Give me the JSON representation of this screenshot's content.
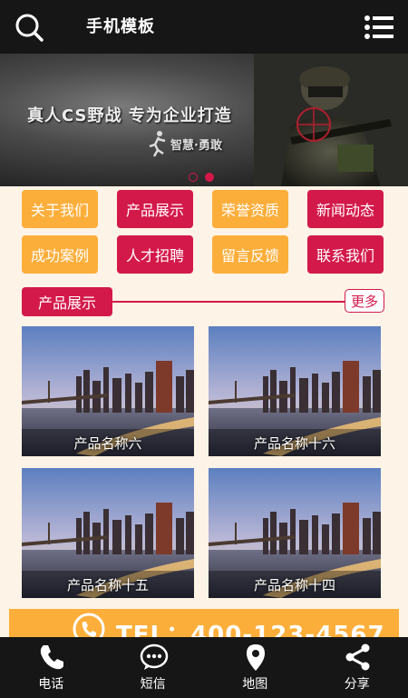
{
  "header": {
    "title": "手机模板",
    "search_icon": "search-icon",
    "menu_icon": "menu-icon"
  },
  "banner": {
    "slogan": "真人CS野战 专为企业打造",
    "subtitle": "智慧·勇敢",
    "slide_count": 2,
    "active_slide": 2
  },
  "nav": {
    "items": [
      {
        "label": "关于我们",
        "color": "#fcae3a"
      },
      {
        "label": "产品展示",
        "color": "#d3194a"
      },
      {
        "label": "荣誉资质",
        "color": "#fcae3a"
      },
      {
        "label": "新闻动态",
        "color": "#d3194a"
      },
      {
        "label": "成功案例",
        "color": "#fcae3a"
      },
      {
        "label": "人才招聘",
        "color": "#d3194a"
      },
      {
        "label": "留言反馈",
        "color": "#fcae3a"
      },
      {
        "label": "联系我们",
        "color": "#d3194a"
      }
    ]
  },
  "products": {
    "title": "产品展示",
    "more": "更多",
    "items": [
      {
        "name": "产品名称六"
      },
      {
        "name": "产品名称十六"
      },
      {
        "name": "产品名称十五"
      },
      {
        "name": "产品名称十四"
      }
    ]
  },
  "contact": {
    "tel": "TEL：400-123-4567"
  },
  "footer": {
    "items": [
      {
        "label": "电话",
        "icon": "phone-icon"
      },
      {
        "label": "短信",
        "icon": "message-icon"
      },
      {
        "label": "地图",
        "icon": "map-pin-icon"
      },
      {
        "label": "分享",
        "icon": "share-icon"
      }
    ]
  },
  "colors": {
    "accent_orange": "#fcae3a",
    "accent_crimson": "#d3194a",
    "header_bg": "#161616",
    "page_bg": "#fdf3e6"
  }
}
